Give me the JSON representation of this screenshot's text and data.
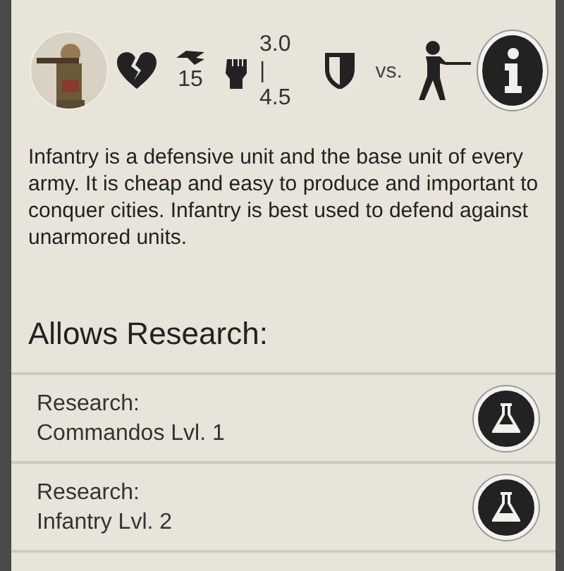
{
  "unit": {
    "speed": "15",
    "attack": [
      "3.0 |",
      "4.5"
    ],
    "versus": "vs."
  },
  "description": "Infantry is a defensive unit and the base unit of every army. It is cheap and easy to produce and important to conquer cities. Infantry is best used to defend against unarmored units.",
  "allows_heading": "Allows Research:",
  "research": [
    {
      "label": "Research:",
      "name": "Commandos Lvl. 1"
    },
    {
      "label": "Research:",
      "name": "Infantry Lvl. 2"
    }
  ]
}
